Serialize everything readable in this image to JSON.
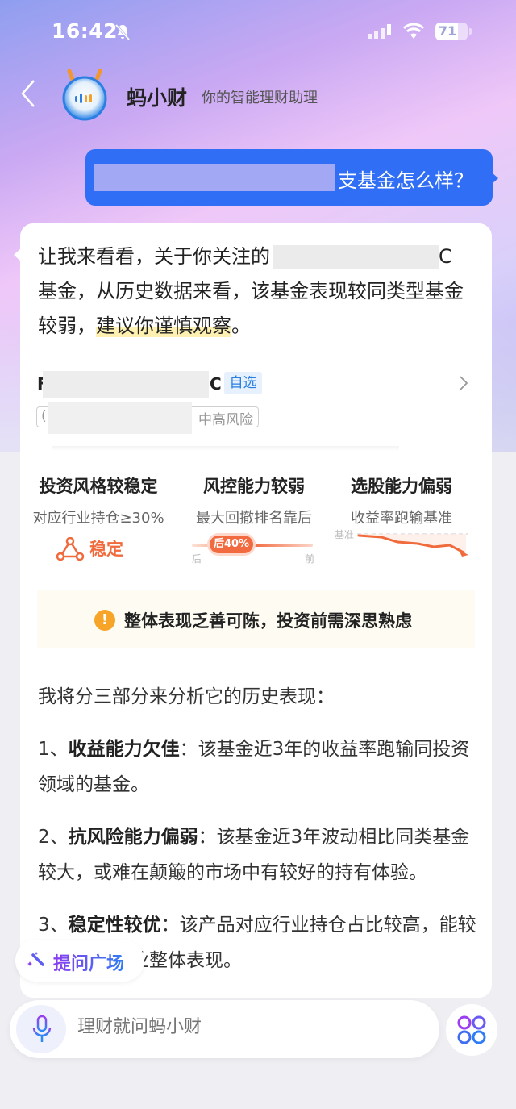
{
  "status_bar": {
    "time": "16:42",
    "battery_level": "71",
    "battery_fraction": 0.71
  },
  "header": {
    "back_icon": "chevron-left-icon",
    "app_name": "蚂小财",
    "subtitle": "你的智能理财助理"
  },
  "user_message": {
    "visible_text": "支基金怎么样？"
  },
  "ai_response": {
    "intro_part1": "让我来看看，关于你关注的",
    "intro_edge": "C",
    "intro_part2": "基金，从历史数据来看，该基金表现较同类型基金较弱，",
    "intro_highlight": "建议你谨慎观察",
    "intro_end": "。",
    "fund_card": {
      "name_edge_left": "F",
      "name_edge_right": "C",
      "watchlist_label": "自选",
      "tag_edge": "(",
      "tag_text": "中高风险"
    },
    "metrics": [
      {
        "title": "投资风格较稳定",
        "subtitle": "对应行业持仓≥30%",
        "badge": "稳定",
        "icon": "triangle-nodes-icon"
      },
      {
        "title": "风控能力较弱",
        "subtitle": "最大回撤排名靠后",
        "rank_label": "后40%",
        "rank_fraction": 0.4,
        "left_label": "后",
        "right_label": "前"
      },
      {
        "title": "选股能力偏弱",
        "subtitle": "收益率跑输基准",
        "benchmark_label": "基准"
      }
    ],
    "warning": {
      "icon": "exclamation-icon",
      "text": "整体表现乏善可陈，投资前需深思熟虑"
    },
    "analysis_intro": "我将分三部分来分析它的历史表现：",
    "points": [
      {
        "prefix": "1、",
        "title": "收益能力欠佳",
        "body": "：该基金近3年的收益率跑输同投资领域的基金。"
      },
      {
        "prefix": "2、",
        "title": "抗风险能力偏弱",
        "body": "：该基金近3年波动相比同类基金较大，或难在颠簸的市场中有较好的持有体验。"
      },
      {
        "prefix": "3、",
        "title": "稳定性较优",
        "body": "：该产品对应行业持仓占比较高，能较好反映该行业整体表现。"
      }
    ]
  },
  "floating": {
    "question_plaza_label": "提问广场"
  },
  "input_bar": {
    "placeholder": "理财就问蚂小财"
  },
  "colors": {
    "user_bubble": "#2f6ef5",
    "accent_orange": "#f26a3f",
    "warning_yellow": "#f6a529",
    "watchlist_blue": "#2a7fe0"
  }
}
